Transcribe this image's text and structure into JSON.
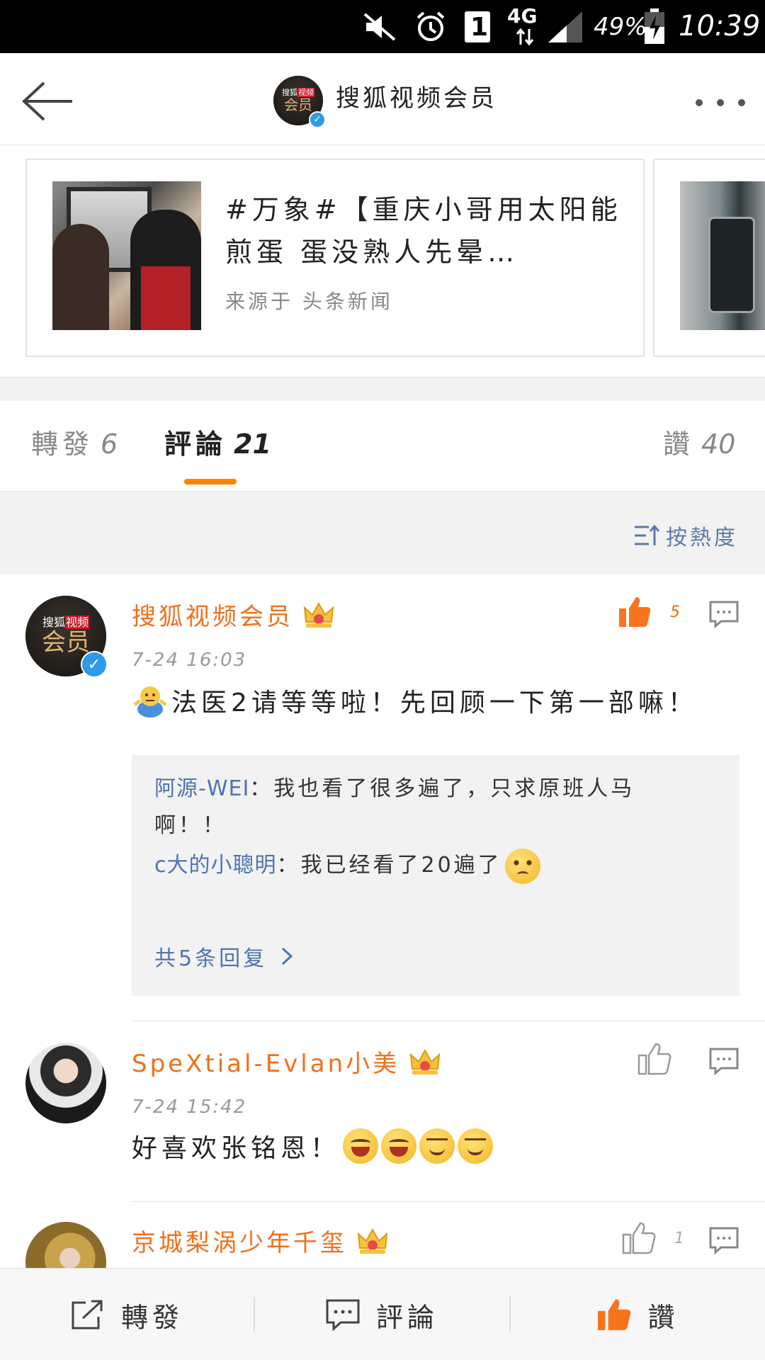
{
  "status_bar": {
    "sim_slot": "1",
    "network": "4G",
    "battery": "49%",
    "time": "10:39"
  },
  "header": {
    "title": "搜狐视频会员",
    "avatar_brand": "搜狐",
    "avatar_brand_tag": "视频",
    "avatar_text": "会员"
  },
  "news_card": {
    "title": "#万象#【重庆小哥用太阳能煎蛋 蛋没熟人先晕…",
    "source": "来源于 头条新闻"
  },
  "tabs": [
    {
      "label": "轉發",
      "count": "6"
    },
    {
      "label": "評論",
      "count": "21"
    },
    {
      "label": "讚",
      "count": "40"
    }
  ],
  "sort": {
    "label": "按熱度"
  },
  "comments": [
    {
      "user": "搜狐视频会员",
      "time": "7-24 16:03",
      "text": "法医2请等等啦！先回顾一下第一部嘛！",
      "likes": "5",
      "replies": [
        {
          "user": "阿源-WEI",
          "text": "：我也看了很多遍了，只求原班人马啊！！"
        },
        {
          "user": "c大的小聰明",
          "text": "：我已经看了20遍了"
        }
      ],
      "more_replies": "共5条回复"
    },
    {
      "user": "SpeXtial-Evlan小美",
      "time": "7-24 15:42",
      "text": "好喜欢张铭恩！",
      "likes": ""
    },
    {
      "user": "京城梨涡少年千玺",
      "likes": "1"
    }
  ],
  "toolbar": {
    "repost": "轉發",
    "comment": "評論",
    "like": "讚"
  },
  "colors": {
    "accent": "#ff8200",
    "username": "#f0701a",
    "link": "#4e74b0",
    "verified": "#2d9be8"
  }
}
